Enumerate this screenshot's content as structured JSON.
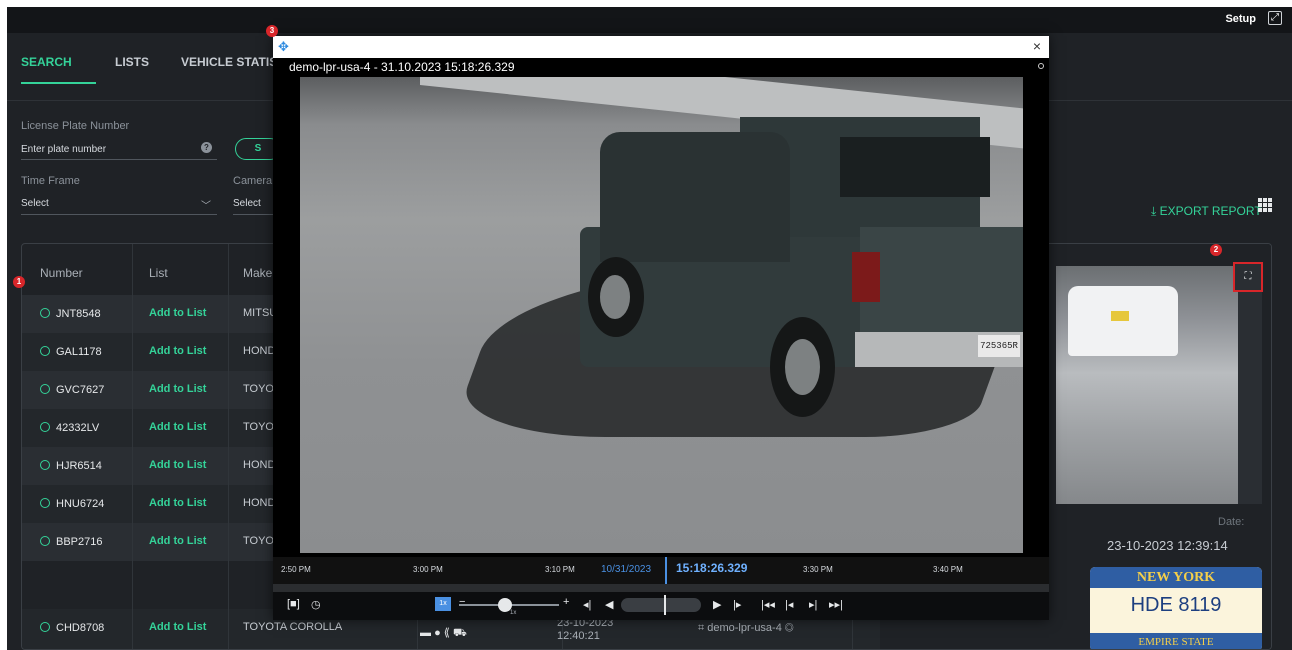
{
  "header": {
    "setup": "Setup",
    "expand_icon": "expand-icon"
  },
  "tabs": [
    {
      "label": "SEARCH",
      "active": true
    },
    {
      "label": "LISTS",
      "active": false
    },
    {
      "label": "VEHICLE STATIS",
      "active": false
    }
  ],
  "filters": {
    "plate_label": "License Plate Number",
    "plate_placeholder": "Enter plate number",
    "search_button": "S",
    "timeframe_label": "Time Frame",
    "timeframe_value": "Select",
    "camera_label": "Camera",
    "camera_value": "Select"
  },
  "export": {
    "label": "EXPORT REPORT"
  },
  "table": {
    "headers": [
      "Number",
      "List",
      "Make"
    ],
    "rows": [
      {
        "plate": "JNT8548",
        "list": "Add to List",
        "make": "MITSU"
      },
      {
        "plate": "GAL1178",
        "list": "Add to List",
        "make": "HOND"
      },
      {
        "plate": "GVC7627",
        "list": "Add to List",
        "make": "TOYO"
      },
      {
        "plate": "42332LV",
        "list": "Add to List",
        "make": "TOYO"
      },
      {
        "plate": "HJR6514",
        "list": "Add to List",
        "make": "HOND"
      },
      {
        "plate": "HNU6724",
        "list": "Add to List",
        "make": "HOND"
      },
      {
        "plate": "BBP2716",
        "list": "Add to List",
        "make": "TOYO"
      },
      {
        "plate": "CHD8708",
        "list": "Add to List",
        "make": "TOYOTA COROLLA"
      }
    ],
    "last_row_time_line1": "23-10-2023",
    "last_row_time_line2": "12:40:21",
    "last_row_camera": "demo-lpr-usa-4"
  },
  "detail": {
    "date_label": "Date:",
    "date_value": "23-10-2023 12:39:14",
    "plate_state": "NEW YORK",
    "plate_number": "HDE 8119",
    "plate_slogan": "EMPIRE STATE"
  },
  "badges": {
    "one": "1",
    "two": "2",
    "three": "3"
  },
  "video_modal": {
    "title": "demo-lpr-usa-4 - 31.10.2023 15:18:26.329",
    "close": "×",
    "truck_plate": "725365R",
    "timeline": {
      "ticks": [
        "2:50 PM",
        "3:00 PM",
        "3:10 PM",
        "3:30 PM",
        "3:40 PM"
      ],
      "date": "10/31/2023",
      "time": "15:18:26.329"
    },
    "controls": {
      "speed": "1x",
      "speed_sub": "1x",
      "plus": "+"
    }
  },
  "colors": {
    "accent": "#34d399",
    "badge": "#d8262a",
    "timeline_blue": "#4a90e2"
  }
}
